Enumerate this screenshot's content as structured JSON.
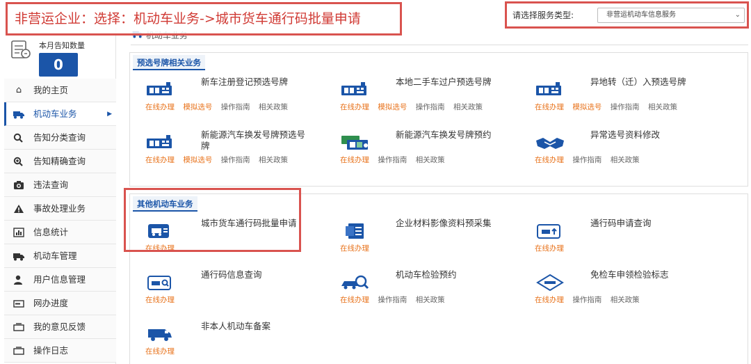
{
  "annotation": {
    "title": "非营运企业：选择：机动车业务->城市货车通行码批量申请"
  },
  "service_type": {
    "label": "请选择服务类型:",
    "selected": "非营运机动车信息服务"
  },
  "sidebar": {
    "notice_label": "本月告知数量",
    "notice_count": "0",
    "items": [
      {
        "label": "我的主页",
        "icon": "home-icon"
      },
      {
        "label": "机动车业务",
        "icon": "truck-icon",
        "active": true
      },
      {
        "label": "告知分类查询",
        "icon": "search-icon"
      },
      {
        "label": "告知精确查询",
        "icon": "zoom-in-icon"
      },
      {
        "label": "违法查询",
        "icon": "camera-icon"
      },
      {
        "label": "事故处理业务",
        "icon": "warning-icon"
      },
      {
        "label": "信息统计",
        "icon": "chart-icon"
      },
      {
        "label": "机动车管理",
        "icon": "truck-icon"
      },
      {
        "label": "用户信息管理",
        "icon": "user-icon"
      },
      {
        "label": "网办进度",
        "icon": "progress-icon"
      },
      {
        "label": "我的意见反馈",
        "icon": "feedback-icon"
      },
      {
        "label": "操作日志",
        "icon": "log-icon"
      }
    ]
  },
  "main": {
    "breadcrumb": "机动车业务",
    "links": {
      "online": "在线办理",
      "sim": "模拟选号",
      "guide": "操作指南",
      "policy": "相关政策"
    },
    "section1": {
      "title": "预选号牌相关业务",
      "cards": [
        {
          "title": "新车注册登记预选号牌",
          "icon": "plate-icon"
        },
        {
          "title": "本地二手车过户预选号牌",
          "icon": "plate-icon"
        },
        {
          "title": "异地转（迁）入预选号牌",
          "icon": "plate-icon"
        },
        {
          "title": "新能源汽车换发号牌预选号牌",
          "icon": "plate-icon"
        },
        {
          "title": "新能源汽车换发号牌预约",
          "icon": "green-plate-icon"
        },
        {
          "title": "异常选号资料修改",
          "icon": "handshake-icon"
        }
      ]
    },
    "section2": {
      "title": "其他机动车业务",
      "cards": [
        {
          "title": "城市货车通行码批量申请",
          "icon": "truck-pass-icon"
        },
        {
          "title": "企业材料影像资料预采集",
          "icon": "document-icon"
        },
        {
          "title": "通行码申请查询",
          "icon": "pass-query-icon"
        },
        {
          "title": "通行码信息查询",
          "icon": "pass-info-icon"
        },
        {
          "title": "机动车检验预约",
          "icon": "car-inspect-icon"
        },
        {
          "title": "免检车申领检验标志",
          "icon": "exempt-badge-icon"
        },
        {
          "title": "非本人机动车备案",
          "icon": "van-icon"
        }
      ]
    }
  }
}
